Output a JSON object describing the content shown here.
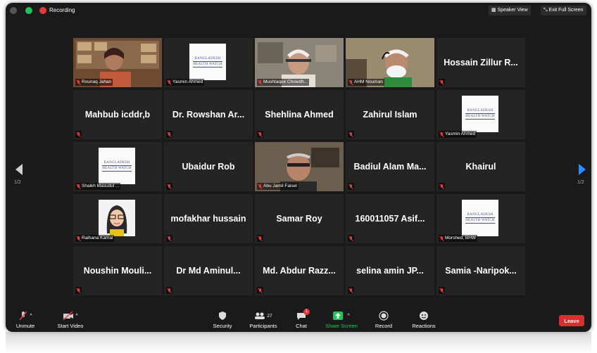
{
  "window": {
    "recording_label": "Recording"
  },
  "top_buttons": {
    "speaker_view": "Speaker View",
    "exit_full_screen": "Exit Full Screen"
  },
  "pager": {
    "left": "1/2",
    "right": "1/2"
  },
  "tiles": [
    {
      "label": "Rounaq Jahan",
      "kind": "video"
    },
    {
      "label": "Yasmin Ahmed",
      "kind": "logo"
    },
    {
      "label": "Mushtaque Chowdh...",
      "kind": "video"
    },
    {
      "label": "AHM Nouman",
      "kind": "video"
    },
    {
      "label": "Hossain Zillur R...",
      "kind": "name"
    },
    {
      "label": "Mahbub icddr,b",
      "kind": "name"
    },
    {
      "label": "Dr. Rowshan Ar...",
      "kind": "name"
    },
    {
      "label": "Shehlina Ahmed",
      "kind": "name"
    },
    {
      "label": "Zahirul Islam",
      "kind": "name"
    },
    {
      "label": "Yasmin Ahmed",
      "kind": "logo"
    },
    {
      "label": "Shaikh Masudul ...",
      "kind": "logo"
    },
    {
      "label": "Ubaidur Rob",
      "kind": "name"
    },
    {
      "label": "Abu Jamil Faisel",
      "kind": "video"
    },
    {
      "label": "Badiul Alam Ma...",
      "kind": "name"
    },
    {
      "label": "Khairul",
      "kind": "name"
    },
    {
      "label": "Raihana Kamal",
      "kind": "avatar"
    },
    {
      "label": "mofakhar hussain",
      "kind": "name"
    },
    {
      "label": "Samar Roy",
      "kind": "name"
    },
    {
      "label": "160011057 Asif...",
      "kind": "name"
    },
    {
      "label": "Morshed, BHW",
      "kind": "logo"
    },
    {
      "label": "Noushin Mouli...",
      "kind": "name"
    },
    {
      "label": "Dr Md Aminul...",
      "kind": "name"
    },
    {
      "label": "Md. Abdur Razz...",
      "kind": "name"
    },
    {
      "label": "selina amin JP...",
      "kind": "name"
    },
    {
      "label": "Samia -Naripok...",
      "kind": "name"
    }
  ],
  "logo_text": {
    "line1": "BANGLADESH",
    "line2": "HEALTH WATCH"
  },
  "toolbar": {
    "unmute": "Unmute",
    "start_video": "Start Video",
    "security": "Security",
    "participants": "Participants",
    "participant_count": "27",
    "chat": "Chat",
    "chat_badge": "1",
    "share_screen": "Share Screen",
    "record": "Record",
    "reactions": "Reactions",
    "leave": "Leave"
  },
  "colors": {
    "active_speaker": "#e5e04e",
    "share_green": "#23c15a",
    "leave_red": "#d92f2f",
    "mute_red": "#e23b3b",
    "nav_blue": "#2d8cff"
  }
}
